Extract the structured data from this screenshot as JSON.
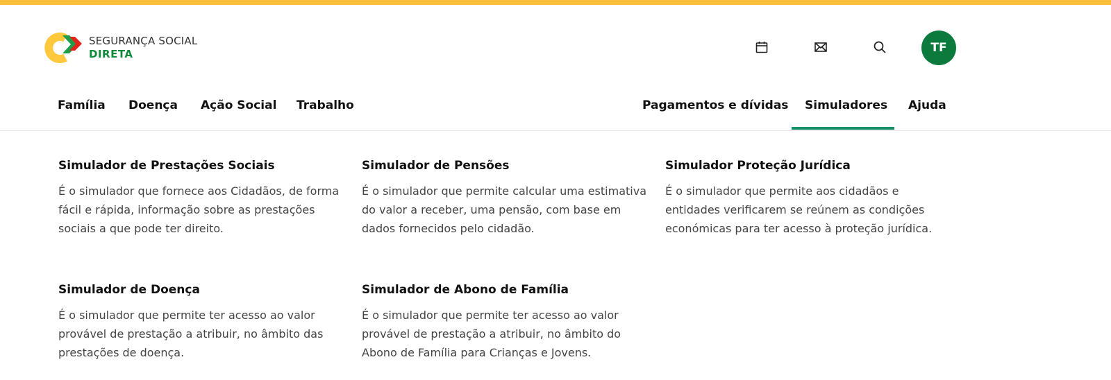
{
  "brand": {
    "line1": "SEGURANÇA SOCIAL",
    "line2": "DIRETA"
  },
  "header": {
    "icons": [
      "calendar-icon",
      "mail-icon",
      "search-icon"
    ],
    "avatar_initials": "TF",
    "avatar_color": "#0b7a3c",
    "top_bar_color": "#ffbe3b"
  },
  "nav": {
    "left": [
      "Família",
      "Doença",
      "Ação Social",
      "Trabalho"
    ],
    "right": [
      "Pagamentos e dívidas",
      "Simuladores",
      "Ajuda"
    ],
    "active": "Simuladores",
    "active_color": "#13926a"
  },
  "simulators": [
    {
      "title": "Simulador de Prestações Sociais",
      "desc": "É o simulador que fornece aos Cidadãos, de forma fácil e rápida, informação sobre as prestações sociais a que pode ter direito."
    },
    {
      "title": "Simulador de Pensões",
      "desc": "É o simulador que permite calcular uma estimativa do valor a receber, uma pensão, com base em dados fornecidos pelo cidadão."
    },
    {
      "title": "Simulador Proteção Jurídica",
      "desc": "É o simulador que permite aos cidadãos e entidades verificarem se reúnem as condições económicas para ter acesso à proteção jurídica."
    },
    {
      "title": "Simulador de Doença",
      "desc": "É o simulador que permite ter acesso ao valor provável de prestação a atribuir, no âmbito das prestações de doença."
    },
    {
      "title": "Simulador de Abono de Família",
      "desc": "É o simulador que permite ter acesso ao valor provável de prestação a atribuir, no âmbito do Abono de Família para Crianças e Jovens."
    }
  ]
}
